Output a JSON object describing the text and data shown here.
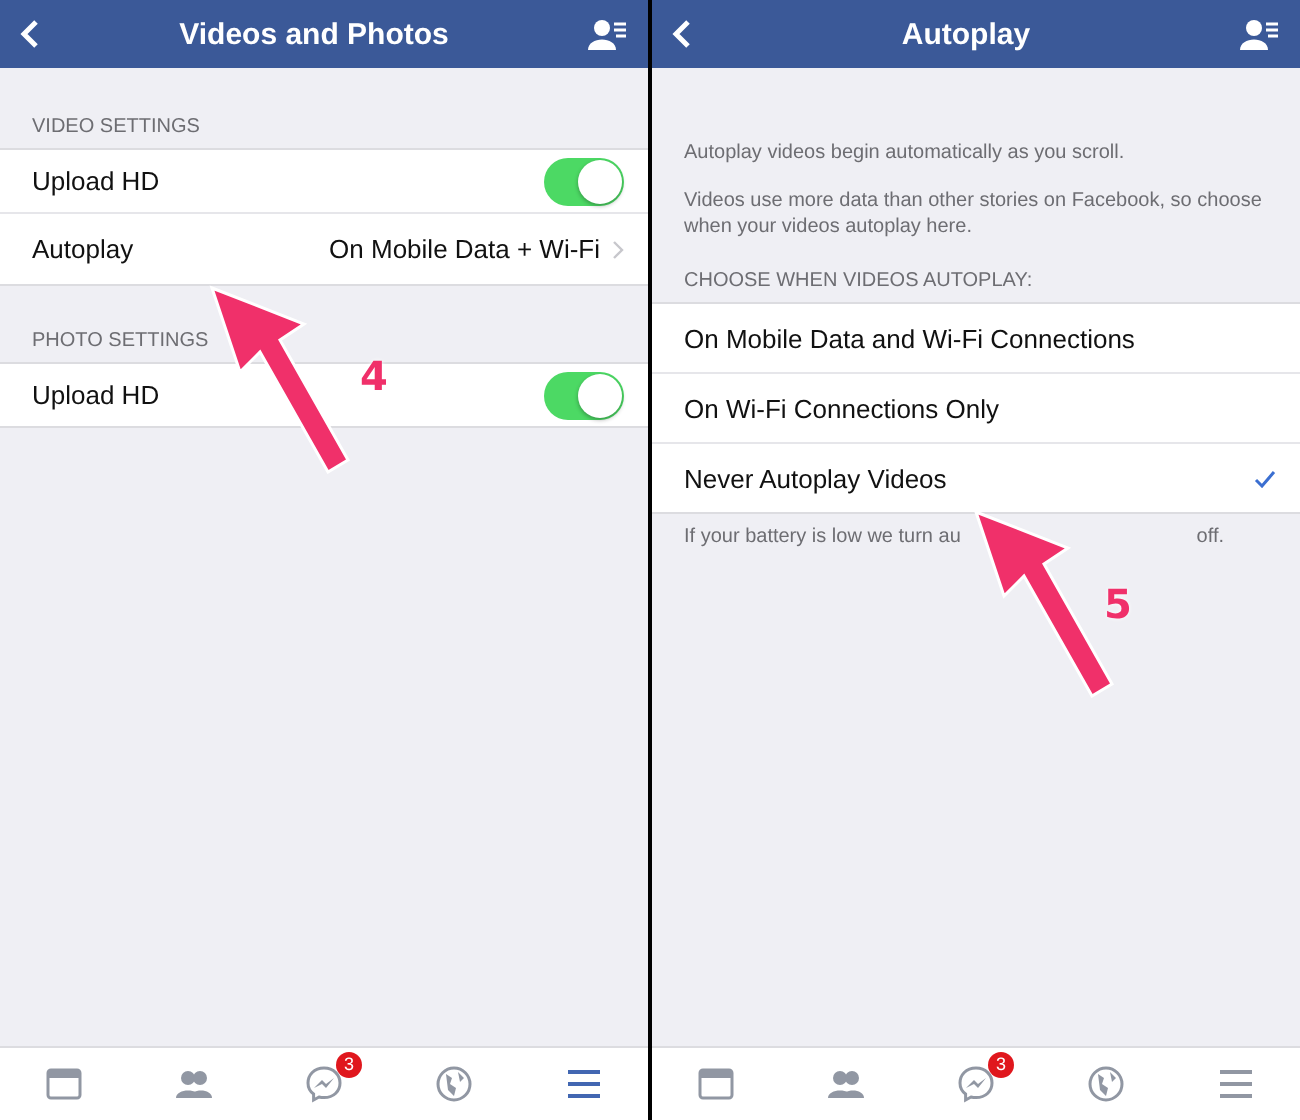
{
  "left_screen": {
    "title": "Videos and Photos",
    "sections": [
      {
        "label": "VIDEO SETTINGS",
        "rows": [
          {
            "kind": "toggle",
            "label": "Upload HD",
            "on": true
          },
          {
            "kind": "link",
            "label": "Autoplay",
            "value": "On Mobile Data + Wi-Fi"
          }
        ]
      },
      {
        "label": "PHOTO SETTINGS",
        "rows": [
          {
            "kind": "toggle",
            "label": "Upload HD",
            "on": true
          }
        ]
      }
    ],
    "annotation": "4",
    "tabs": [
      {
        "kind": "feed",
        "selected": false
      },
      {
        "kind": "friends",
        "selected": false
      },
      {
        "kind": "messenger",
        "badge": "3",
        "selected": false
      },
      {
        "kind": "globe",
        "selected": false
      },
      {
        "kind": "menu",
        "selected": true
      }
    ]
  },
  "right_screen": {
    "title": "Autoplay",
    "paragraphs": [
      "Autoplay videos begin automatically as you scroll.",
      "Videos use more data than other stories on Facebook, so choose when your videos autoplay here."
    ],
    "section_label": "CHOOSE WHEN VIDEOS AUTOPLAY:",
    "options": [
      {
        "label": "On Mobile Data and Wi-Fi Connections",
        "selected": false
      },
      {
        "label": "On Wi-Fi Connections Only",
        "selected": false
      },
      {
        "label": "Never Autoplay Videos",
        "selected": true
      }
    ],
    "footnote_parts": [
      "If your battery is low we turn au",
      "off."
    ],
    "annotation": "5",
    "tabs": [
      {
        "kind": "feed",
        "selected": false
      },
      {
        "kind": "friends",
        "selected": false
      },
      {
        "kind": "messenger",
        "badge": "3",
        "selected": false
      },
      {
        "kind": "globe",
        "selected": false
      },
      {
        "kind": "menu",
        "selected": false
      }
    ]
  }
}
